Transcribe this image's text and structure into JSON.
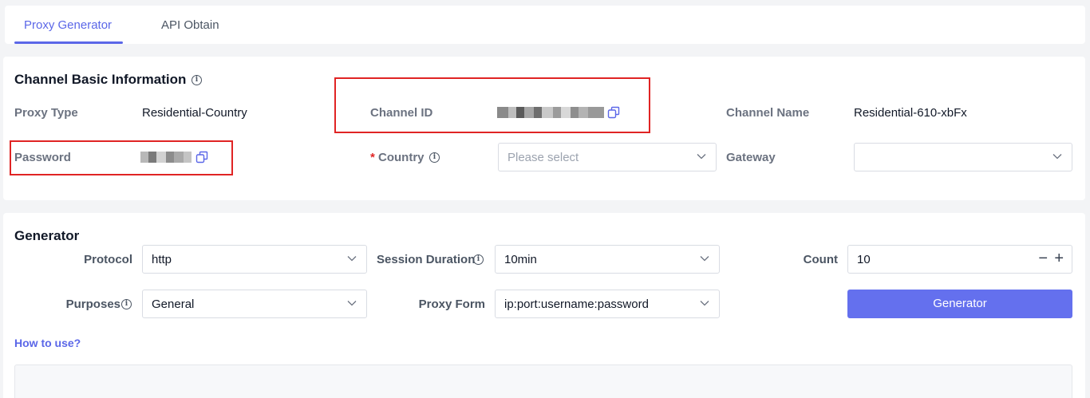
{
  "tabs": [
    {
      "label": "Proxy Generator",
      "active": true
    },
    {
      "label": "API Obtain",
      "active": false
    }
  ],
  "channel": {
    "title": "Channel Basic Information",
    "proxy_type_label": "Proxy Type",
    "proxy_type_value": "Residential-Country",
    "channel_id_label": "Channel ID",
    "channel_name_label": "Channel Name",
    "channel_name_value": "Residential-610-xbFx",
    "password_label": "Password",
    "country_required": "*",
    "country_label": "Country",
    "country_placeholder": "Please select",
    "gateway_label": "Gateway",
    "gateway_value": ""
  },
  "generator": {
    "title": "Generator",
    "protocol_label": "Protocol",
    "protocol_value": "http",
    "session_label": "Session Duration",
    "session_value": "10min",
    "count_label": "Count",
    "count_value": "10",
    "purposes_label": "Purposes",
    "purposes_value": "General",
    "proxy_form_label": "Proxy Form",
    "proxy_form_value": "ip:port:username:password",
    "button_label": "Generator",
    "how_to_use": "How to use?"
  },
  "icons": {
    "info": "info-icon",
    "copy": "copy-icon",
    "chevron": "chevron-down-icon"
  },
  "colors": {
    "accent": "#5b67e8",
    "button": "#6470ee",
    "highlight_box": "#e02424",
    "background": "#f3f4f6"
  }
}
